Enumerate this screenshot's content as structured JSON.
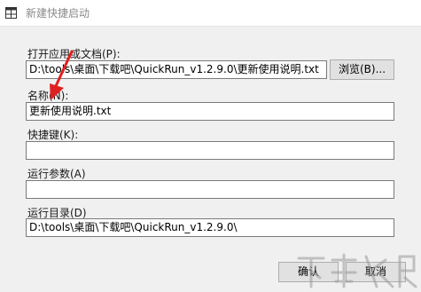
{
  "window": {
    "title": "新建快捷启动"
  },
  "form": {
    "path_label": "打开应用或文档(P):",
    "path_value": "D:\\tools\\桌面\\下载吧\\QuickRun_v1.2.9.0\\更新使用说明.txt",
    "browse_label": "浏览(B)...",
    "name_label": "名称(N):",
    "name_value": "更新使用说明.txt",
    "hotkey_label": "快捷键(K):",
    "hotkey_value": "",
    "params_label": "运行参数(A)",
    "params_value": "",
    "dir_label": "运行目录(D)",
    "dir_value": "D:\\tools\\桌面\\下载吧\\QuickRun_v1.2.9.0\\"
  },
  "footer": {
    "ok_label": "确认",
    "cancel_label": "取消"
  },
  "colors": {
    "annotation_arrow": "#e02020",
    "window_bg": "#f0f0f0",
    "title_text": "#8a8a8a"
  },
  "icons": {
    "app": "grid-window-icon",
    "annotation": "red-arrow-icon",
    "watermark": "site-watermark-logo"
  }
}
